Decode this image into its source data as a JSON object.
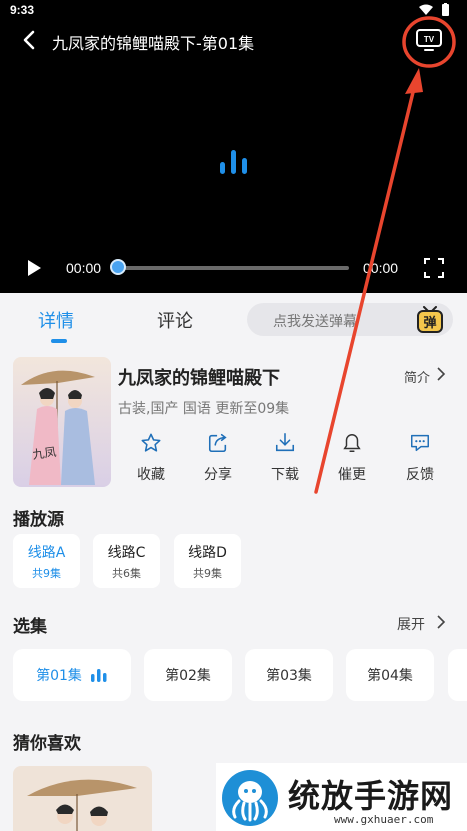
{
  "status_bar": {
    "time": "9:33"
  },
  "player": {
    "title": "九凤家的锦鲤喵殿下-第01集",
    "current_time": "00:00",
    "total_time": "00:00",
    "progress": 0
  },
  "tabs": {
    "details": "详情",
    "comments": "评论",
    "danmaku_placeholder": "点我发送弹幕",
    "danmaku_icon_label": "弹"
  },
  "show": {
    "title": "九凤家的锦鲤喵殿下",
    "meta": "古装,国产 国语 更新至09集",
    "intro_label": "简介"
  },
  "actions": [
    {
      "label": "收藏",
      "icon": "star-icon"
    },
    {
      "label": "分享",
      "icon": "share-icon"
    },
    {
      "label": "下载",
      "icon": "download-icon"
    },
    {
      "label": "催更",
      "icon": "bell-icon"
    },
    {
      "label": "反馈",
      "icon": "feedback-icon"
    }
  ],
  "sources": {
    "title": "播放源",
    "items": [
      {
        "name": "线路A",
        "count": "共9集"
      },
      {
        "name": "线路C",
        "count": "共6集"
      },
      {
        "name": "线路D",
        "count": "共9集"
      }
    ]
  },
  "episodes": {
    "title": "选集",
    "expand_label": "展开",
    "items": [
      "第01集",
      "第02集",
      "第03集",
      "第04集"
    ]
  },
  "recommend": {
    "title": "猜你喜欢"
  },
  "watermark": {
    "text": "统放手游网",
    "url": "www.gxhuaer.com"
  },
  "colors": {
    "accent": "#1f8fe8",
    "annotation": "#e8452e"
  }
}
